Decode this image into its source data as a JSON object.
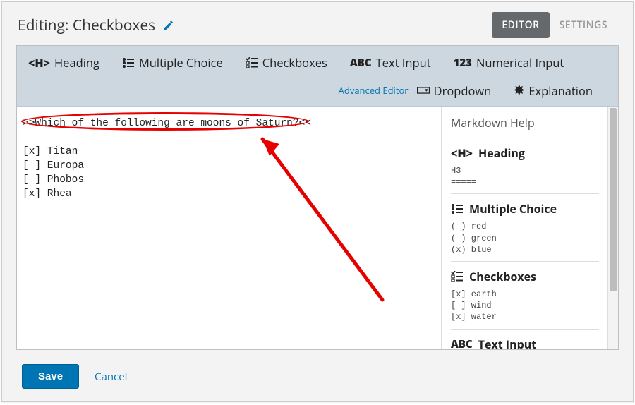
{
  "header": {
    "title": "Editing: Checkboxes",
    "edit_icon": "pencil"
  },
  "tabs": {
    "editor": "EDITOR",
    "settings": "SETTINGS",
    "active": "editor"
  },
  "toolbar": {
    "heading": "Heading",
    "multiple_choice": "Multiple Choice",
    "checkboxes": "Checkboxes",
    "text_input": "Text Input",
    "numerical_input": "Numerical Input",
    "dropdown": "Dropdown",
    "explanation": "Explanation",
    "advanced_editor": "Advanced Editor"
  },
  "editor": {
    "content": ">>Which of the following are moons of Saturn?<<\n\n[x] Titan\n[ ] Europa\n[ ] Phobos\n[x] Rhea"
  },
  "help": {
    "title": "Markdown Help",
    "heading": {
      "label": "Heading",
      "sample": "H3\n====="
    },
    "mc": {
      "label": "Multiple Choice",
      "sample": "( ) red\n( ) green\n(x) blue"
    },
    "cb": {
      "label": "Checkboxes",
      "sample": "[x] earth\n[ ] wind\n[x] water"
    },
    "ti": {
      "label": "Text Input"
    }
  },
  "footer": {
    "save": "Save",
    "cancel": "Cancel"
  },
  "icons": {
    "heading_glyph": "<H>",
    "abc_glyph": "ABC",
    "num_glyph": "123",
    "explanation_glyph": "✸"
  }
}
